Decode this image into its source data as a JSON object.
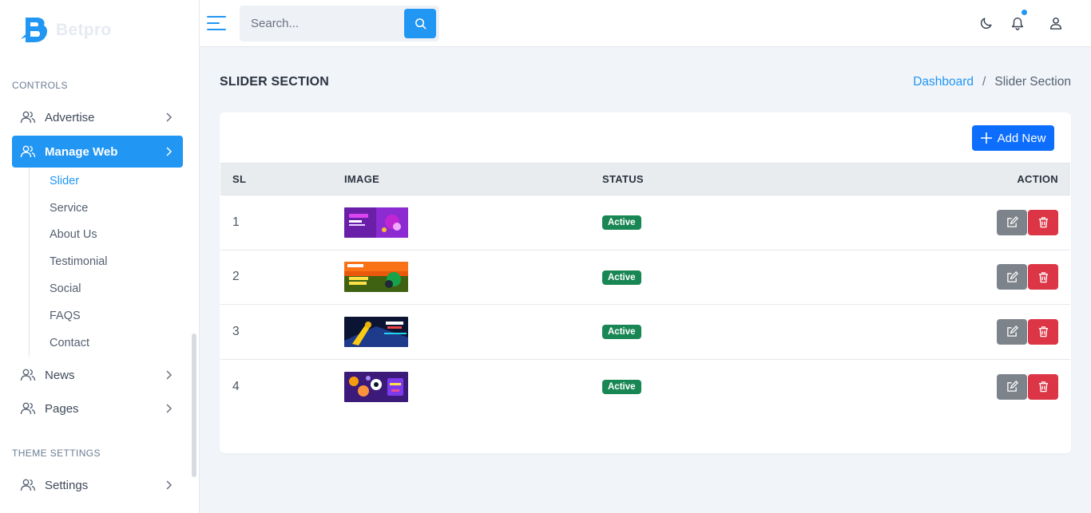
{
  "brand": {
    "name": "Betpro"
  },
  "sidebar": {
    "sections": [
      {
        "label": "CONTROLS"
      },
      {
        "label": "THEME SETTINGS"
      }
    ],
    "items": [
      {
        "label": "Advertise",
        "icon": "users-icon"
      },
      {
        "label": "Manage Web",
        "icon": "users-icon",
        "active": true
      },
      {
        "label": "News",
        "icon": "users-icon"
      },
      {
        "label": "Pages",
        "icon": "users-icon"
      },
      {
        "label": "Settings",
        "icon": "users-icon"
      }
    ],
    "subitems": [
      {
        "label": "Slider",
        "active": true
      },
      {
        "label": "Service"
      },
      {
        "label": "About Us"
      },
      {
        "label": "Testimonial"
      },
      {
        "label": "Social"
      },
      {
        "label": "FAQS"
      },
      {
        "label": "Contact"
      }
    ]
  },
  "topbar": {
    "search": {
      "placeholder": "Search..."
    },
    "icons": [
      "menu-icon",
      "search-icon",
      "moon-icon",
      "bell-icon",
      "user-icon"
    ]
  },
  "page": {
    "title": "SLIDER SECTION",
    "breadcrumb": {
      "home": "Dashboard",
      "separator": "/",
      "current": "Slider Section"
    },
    "add_button": "Add New"
  },
  "table": {
    "headers": {
      "sl": "SL",
      "image": "IMAGE",
      "status": "STATUS",
      "action": "ACTION"
    },
    "rows": [
      {
        "sl": "1",
        "status": "Active",
        "image_theme": "purple-casino"
      },
      {
        "sl": "2",
        "status": "Active",
        "image_theme": "fifa-world-cup"
      },
      {
        "sl": "3",
        "status": "Active",
        "image_theme": "cricket"
      },
      {
        "sl": "4",
        "status": "Active",
        "image_theme": "purple-sports"
      }
    ]
  },
  "colors": {
    "primary": "#2196f3",
    "button_primary": "#0d6efd",
    "badge_active": "#198754",
    "edit": "#7d838a",
    "delete": "#dc3545"
  }
}
